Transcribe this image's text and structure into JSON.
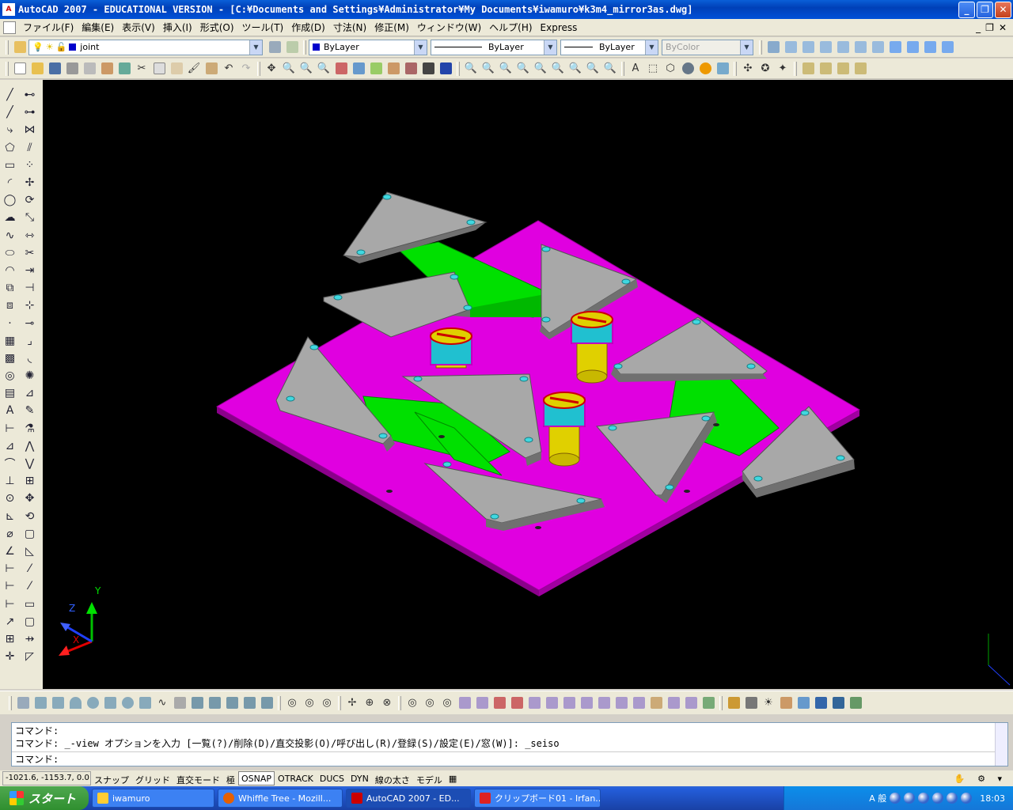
{
  "window": {
    "title": "AutoCAD 2007 - EDUCATIONAL VERSION - [C:¥Documents and Settings¥Administrator¥My Documents¥iwamuro¥k3m4_mirror3as.dwg]",
    "minimize": "_",
    "restore": "❐",
    "close": "✕"
  },
  "menu": [
    "ファイル(F)",
    "編集(E)",
    "表示(V)",
    "挿入(I)",
    "形式(O)",
    "ツール(T)",
    "作成(D)",
    "寸法(N)",
    "修正(M)",
    "ウィンドウ(W)",
    "ヘルプ(H)",
    "Express"
  ],
  "layers": {
    "layer_name": "joint",
    "color": "ByLayer",
    "linetype": "ByLayer",
    "lineweight": "ByLayer",
    "plotstyle": "ByColor"
  },
  "ucs": {
    "x": "X",
    "y": "Y",
    "z": "Z"
  },
  "command": {
    "lines": [
      "コマンド:",
      "コマンド: _-view オプションを入力 [一覧(?)/削除(D)/直交投影(O)/呼び出し(R)/登録(S)/設定(E)/窓(W)]: _seiso"
    ],
    "prompt": "コマンド:"
  },
  "status": {
    "coords": "-1021.6, -1153.7, 0.0",
    "buttons": [
      "スナップ",
      "グリッド",
      "直交モード",
      "極",
      "OSNAP",
      "OTRACK",
      "DUCS",
      "DYN",
      "線の太さ",
      "モデル"
    ],
    "active": "OSNAP"
  },
  "taskbar": {
    "start": "スタート",
    "tasks": [
      "iwamuro",
      "Whiffle Tree - Mozill...",
      "AutoCAD 2007 - ED...",
      "クリップボード01 - Irfan..."
    ],
    "active_task": "AutoCAD 2007 - ED...",
    "ime": "A 般",
    "clock": "18:03"
  },
  "colors": {
    "plate": "#e000e0",
    "link": "#00e000",
    "triangle": "#a8a8a8",
    "hole": "#40d8e0",
    "pivot": "#e0d000"
  }
}
